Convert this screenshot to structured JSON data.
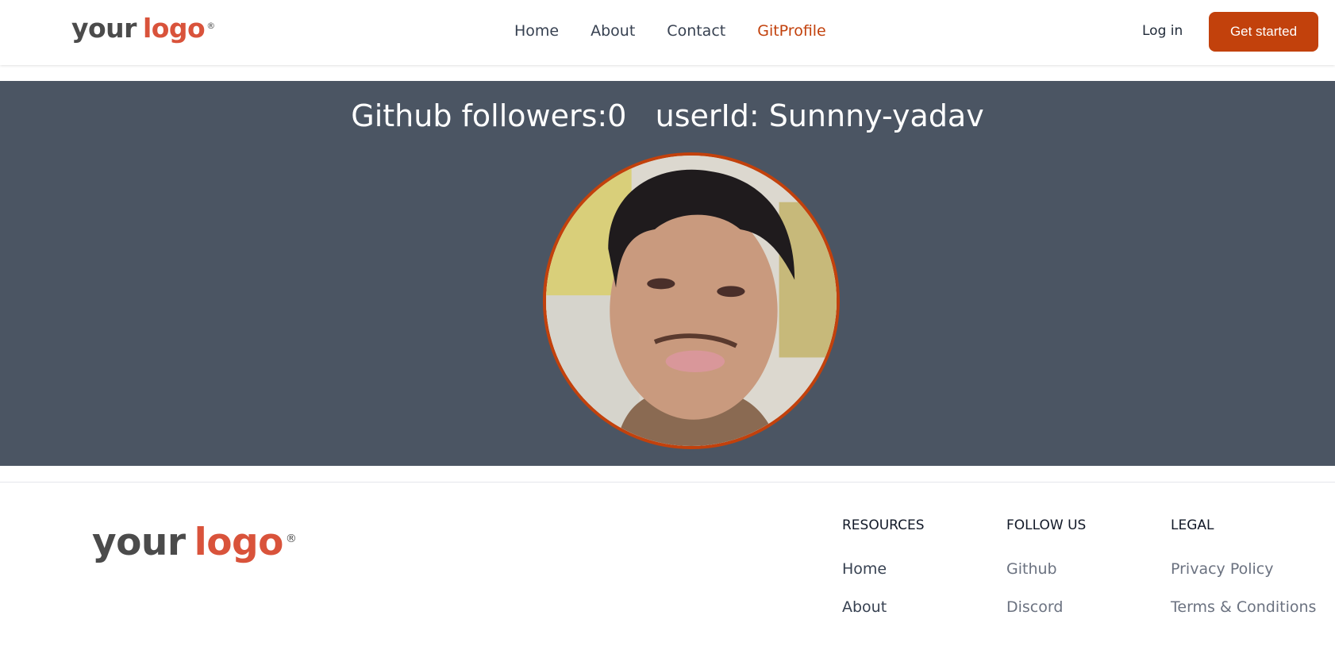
{
  "header": {
    "logo": {
      "word1": "your",
      "word2": "logo",
      "mark": "®"
    },
    "nav": [
      {
        "label": "Home"
      },
      {
        "label": "About"
      },
      {
        "label": "Contact"
      },
      {
        "label": "GitProfile",
        "active": true
      }
    ],
    "login_label": "Log in",
    "cta_label": "Get started"
  },
  "profile": {
    "heading": "Github followers:0   userId: Sunnny-yadav",
    "avatar_alt": "avatar"
  },
  "footer": {
    "logo": {
      "word1": "your",
      "word2": "logo",
      "mark": "®"
    },
    "columns": [
      {
        "title": "RESOURCES",
        "links": [
          "Home",
          "About"
        ]
      },
      {
        "title": "FOLLOW US",
        "links": [
          "Github",
          "Discord"
        ]
      },
      {
        "title": "LEGAL",
        "links": [
          "Privacy Policy",
          "Terms & Conditions"
        ]
      }
    ]
  },
  "colors": {
    "accent": "#c2410c",
    "logo_red": "#d9533b",
    "hero_bg": "#4b5563"
  }
}
